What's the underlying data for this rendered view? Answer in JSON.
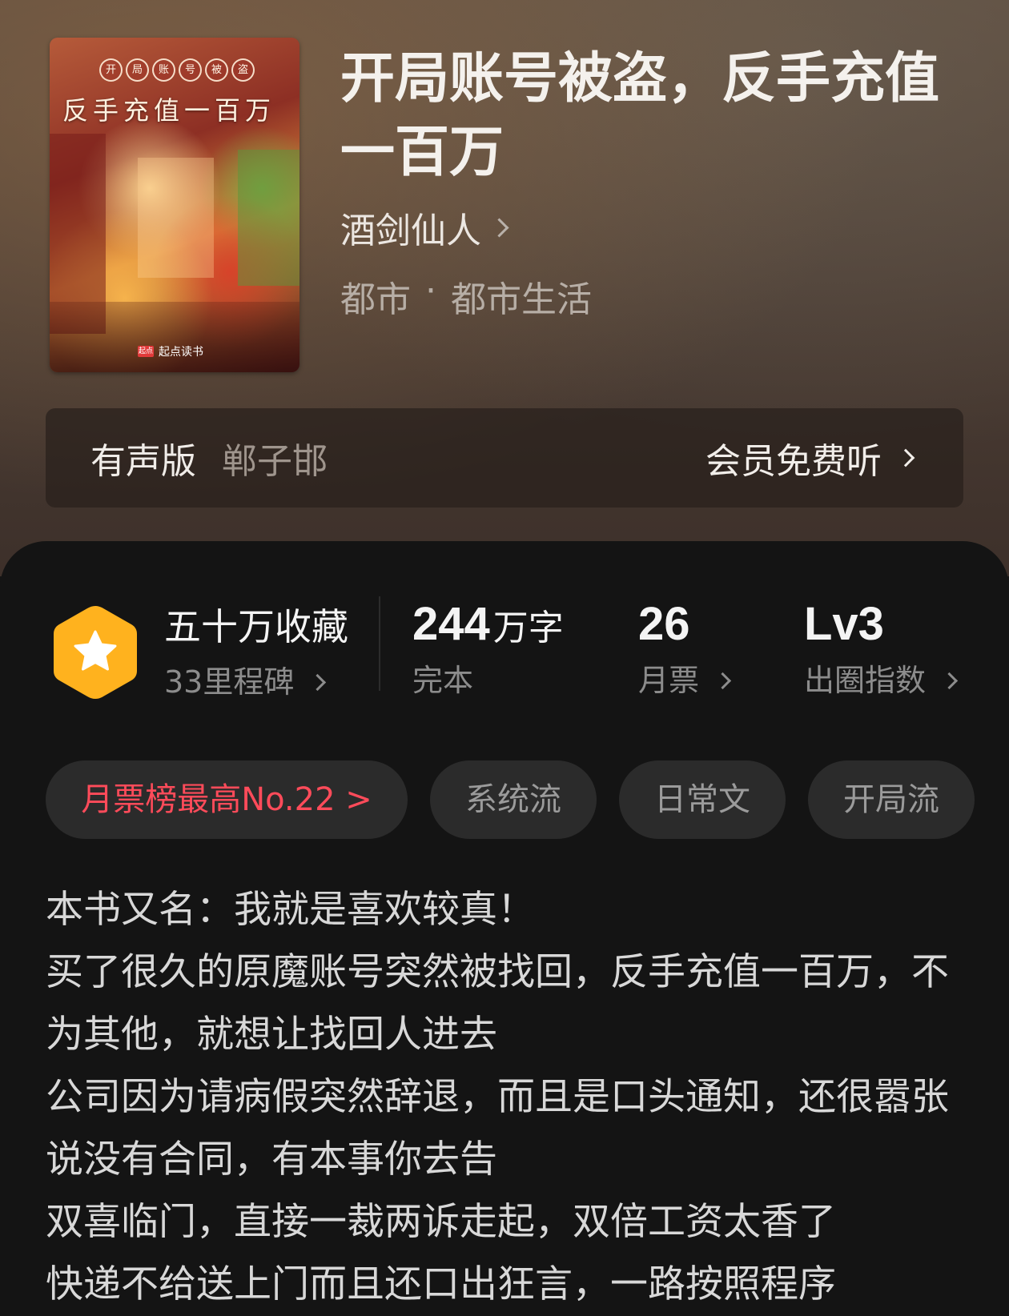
{
  "book": {
    "title": "开局账号被盗，反手充值一百万",
    "author": "酒剑仙人",
    "category": "都市",
    "genre_separator": "·",
    "subcategory": "都市生活",
    "cover": {
      "seals": [
        "开",
        "局",
        "账",
        "号",
        "被",
        "盗"
      ],
      "title": "反手充值一百万",
      "brand_mark": "起点",
      "brand": "起点读书"
    }
  },
  "audio": {
    "label": "有声版",
    "narrator": "郸子邯",
    "cta": "会员免费听"
  },
  "stats": {
    "collection": "五十万收藏",
    "milestone": "33里程碑",
    "word_count_value": "244",
    "word_count_unit": "万字",
    "status": "完本",
    "monthly_tickets_value": "26",
    "monthly_tickets_label": "月票",
    "circle_index_value": "Lv3",
    "circle_index_label": "出圈指数"
  },
  "tags": {
    "rank": "月票榜最高No.22 >",
    "items": [
      "系统流",
      "日常文",
      "开局流"
    ]
  },
  "synopsis": [
    "本书又名：我就是喜欢较真！",
    "买了很久的原魔账号突然被找回，反手充值一百万，不为其他，就想让找回人进去",
    "公司因为请病假突然辞退，而且是口头通知，还很嚣张说没有合同，有本事你去告",
    "双喜临门，直接一裁两诉走起，双倍工资太香了",
    "快递不给送上门而且还口出狂言，一路按照程序"
  ],
  "colors": {
    "accent_rank": "#ff4b5a",
    "badge_orange": "#ffb21e",
    "panel_bg": "#141414"
  }
}
